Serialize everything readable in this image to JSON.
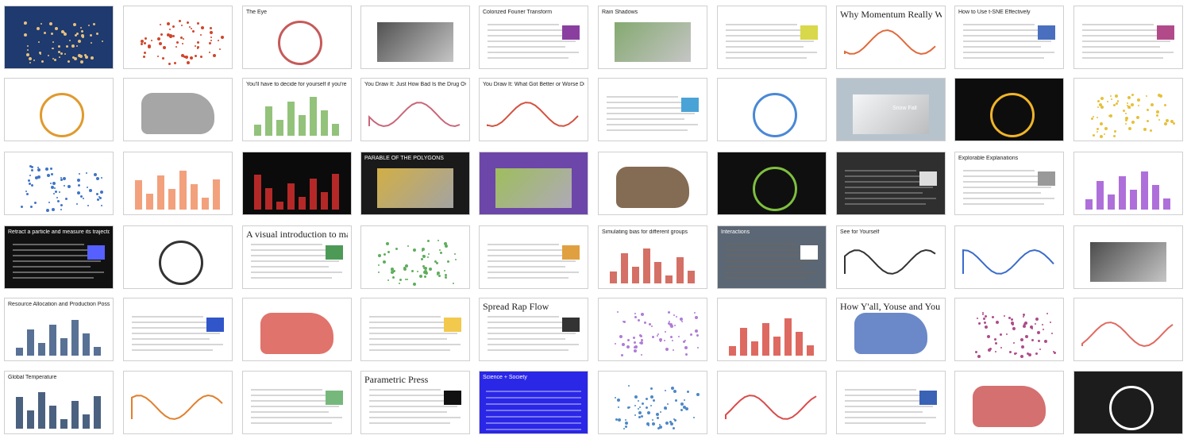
{
  "gallery": {
    "thumbnails": [
      {
        "title": "",
        "bg": "#1e3a6e",
        "accent": "#e8c07d",
        "kind": "dots-dark"
      },
      {
        "title": "",
        "bg": "#ffffff",
        "accent": "#d0452b",
        "kind": "scatter"
      },
      {
        "title": "The Eye",
        "bg": "#ffffff",
        "accent": "#c65a5a",
        "kind": "circle-pair"
      },
      {
        "title": "",
        "bg": "#ffffff",
        "accent": "#333333",
        "kind": "faces"
      },
      {
        "title": "Colorized Fourier Transform",
        "bg": "#ffffff",
        "accent": "#8a3fa0",
        "kind": "formula"
      },
      {
        "title": "Rain Shadows",
        "bg": "#ffffff",
        "accent": "#6f9a57",
        "kind": "terrain"
      },
      {
        "title": "",
        "bg": "#ffffff",
        "accent": "#d9d84a",
        "kind": "text"
      },
      {
        "title": "Why Momentum Really Works",
        "bg": "#ffffff",
        "accent": "#e06a3c",
        "kind": "curve"
      },
      {
        "title": "How to Use t-SNE Effectively",
        "bg": "#ffffff",
        "accent": "#4a6fbf",
        "kind": "small-multiples"
      },
      {
        "title": "",
        "bg": "#ffffff",
        "accent": "#b24a8a",
        "kind": "diagram"
      },
      {
        "title": "",
        "bg": "#ffffff",
        "accent": "#e09a2d",
        "kind": "globe"
      },
      {
        "title": "",
        "bg": "#ffffff",
        "accent": "#888888",
        "kind": "map-lines"
      },
      {
        "title": "You'll have to decide for yourself if you're rich or not",
        "bg": "#ffffff",
        "accent": "#78b35a",
        "kind": "bars"
      },
      {
        "title": "You Draw It: Just How Bad Is the Drug Overdose Epidemic?",
        "bg": "#ffffff",
        "accent": "#c9677a",
        "kind": "band"
      },
      {
        "title": "You Draw It: What Got Better or Worse During Obama's Presidency",
        "bg": "#ffffff",
        "accent": "#d4523f",
        "kind": "line"
      },
      {
        "title": "",
        "bg": "#ffffff",
        "accent": "#4aa3d6",
        "kind": "flow"
      },
      {
        "title": "",
        "bg": "#ffffff",
        "accent": "#4a88d6",
        "kind": "rings"
      },
      {
        "title": "Snow Fall",
        "bg": "#b7c3cc",
        "accent": "#ffffff",
        "kind": "photo"
      },
      {
        "title": "",
        "bg": "#0d0d0d",
        "accent": "#f0b429",
        "kind": "radial"
      },
      {
        "title": "",
        "bg": "#ffffff",
        "accent": "#e5c13a",
        "kind": "scatter-text"
      },
      {
        "title": "",
        "bg": "#ffffff",
        "accent": "#3f74c7",
        "kind": "dots"
      },
      {
        "title": "",
        "bg": "#ffffff",
        "accent": "#f08a5d",
        "kind": "fill-grid"
      },
      {
        "title": "",
        "bg": "#0b0b0b",
        "accent": "#e03030",
        "kind": "histogram"
      },
      {
        "title": "PARABLE OF THE POLYGONS",
        "bg": "#1a1a1a",
        "accent": "#f2c94c",
        "kind": "polygons"
      },
      {
        "title": "",
        "bg": "#6c46a8",
        "accent": "#a7d34e",
        "kind": "isometric"
      },
      {
        "title": "",
        "bg": "#ffffff",
        "accent": "#5b3a1a",
        "kind": "map-africa"
      },
      {
        "title": "",
        "bg": "#0f0f0f",
        "accent": "#7fbf3f",
        "kind": "space"
      },
      {
        "title": "",
        "bg": "#2f2f2f",
        "accent": "#dddddd",
        "kind": "doc-dark"
      },
      {
        "title": "Explorable Explanations",
        "bg": "#ffffff",
        "accent": "#999999",
        "kind": "article"
      },
      {
        "title": "",
        "bg": "#ffffff",
        "accent": "#9b4bd1",
        "kind": "mosaic"
      },
      {
        "title": "Retract a particle and measure its trajectory",
        "bg": "#111111",
        "accent": "#5560ff",
        "kind": "physics"
      },
      {
        "title": "",
        "bg": "#ffffff",
        "accent": "#333333",
        "kind": "nodes"
      },
      {
        "title": "A visual introduction to machine learning",
        "bg": "#ffffff",
        "accent": "#4d9a57",
        "kind": "intro"
      },
      {
        "title": "",
        "bg": "#ffffff",
        "accent": "#5fae5d",
        "kind": "scatter-small"
      },
      {
        "title": "",
        "bg": "#ffffff",
        "accent": "#e0a040",
        "kind": "code"
      },
      {
        "title": "Simulating bias for different groups",
        "bg": "#ffffff",
        "accent": "#c94c3f",
        "kind": "bias"
      },
      {
        "title": "Interactions",
        "bg": "#5c6775",
        "accent": "#ffffff",
        "kind": "text-dark"
      },
      {
        "title": "See for Yourself",
        "bg": "#ffffff",
        "accent": "#333333",
        "kind": "time-series"
      },
      {
        "title": "",
        "bg": "#ffffff",
        "accent": "#3a6bcc",
        "kind": "sine"
      },
      {
        "title": "",
        "bg": "#ffffff",
        "accent": "#2c2c2c",
        "kind": "photos"
      },
      {
        "title": "Resource Allocation and Production Possibilities",
        "bg": "#ffffff",
        "accent": "#2e4d7a",
        "kind": "econ"
      },
      {
        "title": "",
        "bg": "#ffffff",
        "accent": "#3056c9",
        "kind": "quiz"
      },
      {
        "title": "",
        "bg": "#ffffff",
        "accent": "#d6443a",
        "kind": "usmap-red"
      },
      {
        "title": "",
        "bg": "#ffffff",
        "accent": "#f2c94c",
        "kind": "lists"
      },
      {
        "title": "Spread Rap Flow",
        "bg": "#ffffff",
        "accent": "#333333",
        "kind": "rap"
      },
      {
        "title": "",
        "bg": "#ffffff",
        "accent": "#b07cd6",
        "kind": "dotgrid"
      },
      {
        "title": "",
        "bg": "#ffffff",
        "accent": "#d6443a",
        "kind": "strips"
      },
      {
        "title": "How Y'all, Youse and You Guys Talk",
        "bg": "#ffffff",
        "accent": "#3a62b5",
        "kind": "dialect"
      },
      {
        "title": "",
        "bg": "#ffffff",
        "accent": "#ae4c8a",
        "kind": "scatter2"
      },
      {
        "title": "",
        "bg": "#ffffff",
        "accent": "#e06a60",
        "kind": "lines-soft"
      },
      {
        "title": "Global Temperature",
        "bg": "#ffffff",
        "accent": "#1e3a60",
        "kind": "climate"
      },
      {
        "title": "",
        "bg": "#ffffff",
        "accent": "#e0802e",
        "kind": "bell"
      },
      {
        "title": "",
        "bg": "#ffffff",
        "accent": "#76b87b",
        "kind": "branches"
      },
      {
        "title": "Parametric Press",
        "bg": "#ffffff",
        "accent": "#111111",
        "kind": "press"
      },
      {
        "title": "Science + Society",
        "bg": "#2a27e6",
        "accent": "#f2f2ff",
        "kind": "press-blue"
      },
      {
        "title": "",
        "bg": "#ffffff",
        "accent": "#4d88c7",
        "kind": "stars"
      },
      {
        "title": "",
        "bg": "#ffffff",
        "accent": "#d94b4b",
        "kind": "river"
      },
      {
        "title": "",
        "bg": "#ffffff",
        "accent": "#3a62b5",
        "kind": "tree"
      },
      {
        "title": "",
        "bg": "#ffffff",
        "accent": "#c74040",
        "kind": "usmap-blue"
      },
      {
        "title": "",
        "bg": "#1c1c1c",
        "accent": "#ffffff",
        "kind": "circles-dark"
      },
      {
        "title": "",
        "bg": "#ffffff",
        "accent": "#5e7f3a",
        "kind": "handwriting"
      }
    ]
  }
}
